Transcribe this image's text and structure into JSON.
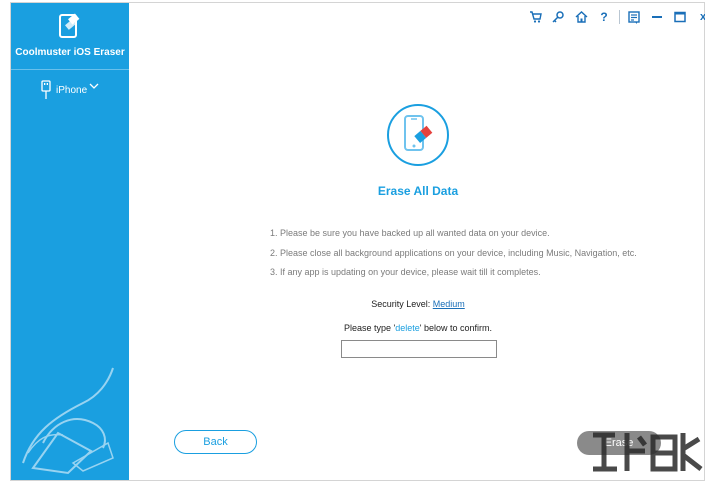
{
  "app": {
    "title": "Coolmuster iOS Eraser"
  },
  "sidebar": {
    "device_label": "iPhone"
  },
  "toolbar": {
    "icons": [
      "cart-icon",
      "key-icon",
      "home-icon",
      "help-icon",
      "feedback-icon",
      "minimize-icon",
      "maximize-icon",
      "close-icon"
    ],
    "help_label": "?",
    "close_label": "x"
  },
  "main": {
    "title": "Erase All Data",
    "instructions": [
      "1. Please be sure you have backed up all wanted data on your device.",
      "2. Please close all background applications on your device, including Music, Navigation, etc.",
      "3. If any app is updating on your device, please wait till it completes."
    ],
    "security_prefix": "Security Level: ",
    "security_level": "Medium",
    "confirm_prefix": "Please type '",
    "confirm_keyword": "delete",
    "confirm_suffix": "' below to confirm.",
    "confirm_value": ""
  },
  "footer": {
    "back_label": "Back",
    "erase_label": "Erase"
  },
  "colors": {
    "accent": "#1a9fe0",
    "link": "#1a6fb8",
    "erase_button": "#8a8a8a"
  }
}
